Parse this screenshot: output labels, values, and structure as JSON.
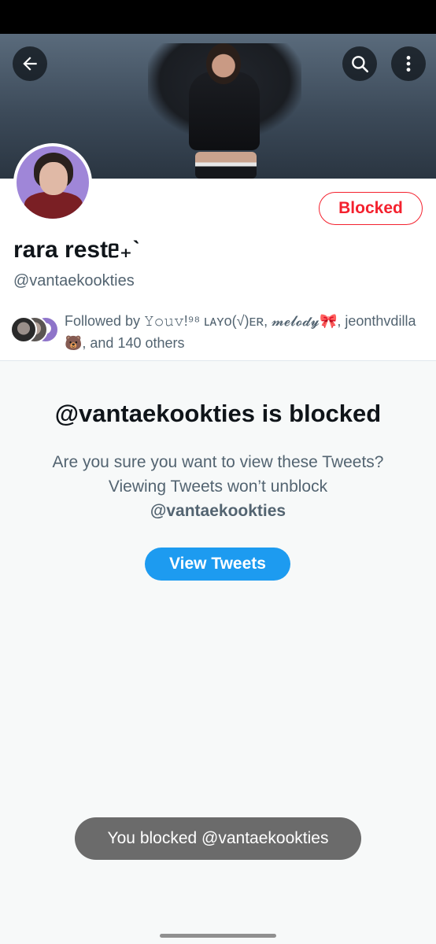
{
  "profile": {
    "display_name": "rara restᥱ₊ˋ",
    "handle": "@vantaekookties",
    "blocked_button": "Blocked",
    "followed_by_text": "Followed by 𝚈𝚘𝚞𝚟!⁹⁸ ʟᴀʏᴏ(√)ᴇʀ, 𝓶𝓮𝓵𝓸𝓭𝔂🎀, jeonthvdilla🐻, and 140 others"
  },
  "header": {
    "back_icon": "arrow-left-icon",
    "search_icon": "search-icon",
    "more_icon": "more-vertical-icon"
  },
  "blocked_notice": {
    "title": "@vantaekookties is blocked",
    "description": "Are you sure you want to view these Tweets? Viewing Tweets won’t unblock",
    "description_handle": "@vantaekookties",
    "view_button": "View Tweets"
  },
  "toast": {
    "message": "You blocked @vantaekookties"
  },
  "colors": {
    "accent": "#1d9bf0",
    "blocked_red": "#f4212e",
    "muted_text": "#536471"
  }
}
